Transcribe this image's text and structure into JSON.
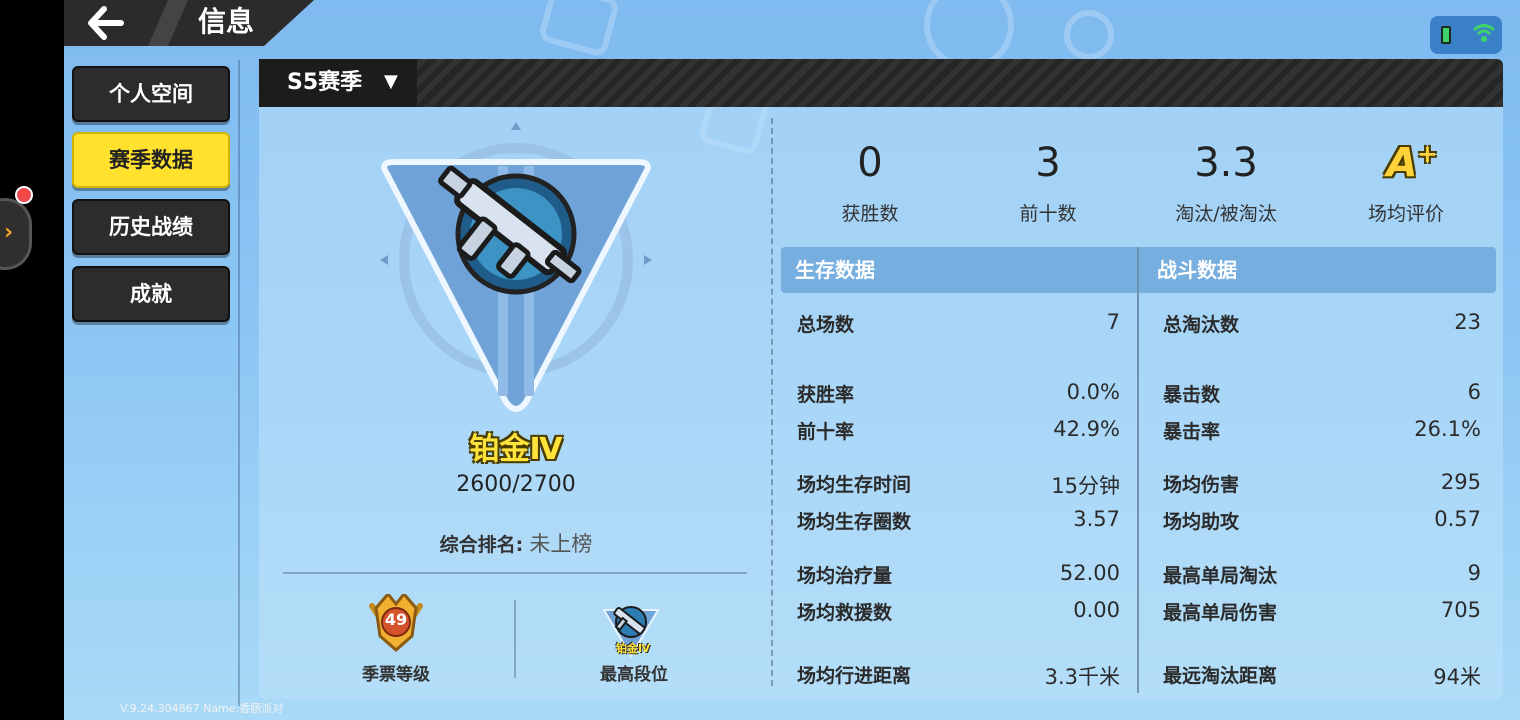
{
  "header": {
    "back_icon": "back-arrow-icon",
    "title": "信息"
  },
  "status": {
    "battery_icon": "battery-icon",
    "wifi_icon": "wifi-icon"
  },
  "sidebar": {
    "items": [
      {
        "label": "个人空间",
        "active": false
      },
      {
        "label": "赛季数据",
        "active": true
      },
      {
        "label": "历史战绩",
        "active": false
      },
      {
        "label": "成就",
        "active": false
      }
    ]
  },
  "season": {
    "label": "S5赛季",
    "dropdown_icon": "caret-down-icon"
  },
  "rank": {
    "tier": "铂金Ⅳ",
    "points": "2600/2700",
    "overall_label": "综合排名:",
    "overall_value": "未上榜"
  },
  "bottom": {
    "pass_level": "49",
    "pass_level_label": "季票等级",
    "best_rank_text": "铂金Ⅳ",
    "best_rank_label": "最高段位"
  },
  "summary": [
    {
      "value": "0",
      "label": "获胜数"
    },
    {
      "value": "3",
      "label": "前十数"
    },
    {
      "value": "3.3",
      "label": "淘汰/被淘汰"
    },
    {
      "value": "A",
      "label": "场均评价",
      "suffix": "+"
    }
  ],
  "survival": {
    "title": "生存数据",
    "rows": [
      {
        "key": "总场数",
        "value": "7"
      },
      {
        "key": "获胜率",
        "value": "0.0%"
      },
      {
        "key": "前十率",
        "value": "42.9%"
      },
      {
        "key": "场均生存时间",
        "value": "15分钟"
      },
      {
        "key": "场均生存圈数",
        "value": "3.57"
      },
      {
        "key": "场均治疗量",
        "value": "52.00"
      },
      {
        "key": "场均救援数",
        "value": "0.00"
      },
      {
        "key": "场均行进距离",
        "value": "3.3千米"
      }
    ]
  },
  "combat": {
    "title": "战斗数据",
    "rows": [
      {
        "key": "总淘汰数",
        "value": "23"
      },
      {
        "key": "暴击数",
        "value": "6"
      },
      {
        "key": "暴击率",
        "value": "26.1%"
      },
      {
        "key": "场均伤害",
        "value": "295"
      },
      {
        "key": "场均助攻",
        "value": "0.57"
      },
      {
        "key": "最高单局淘汰",
        "value": "9"
      },
      {
        "key": "最高单局伤害",
        "value": "705"
      },
      {
        "key": "最远淘汰距离",
        "value": "94米"
      }
    ]
  },
  "footer": {
    "version": "V.9.24.304867 Name:香肠派对"
  }
}
